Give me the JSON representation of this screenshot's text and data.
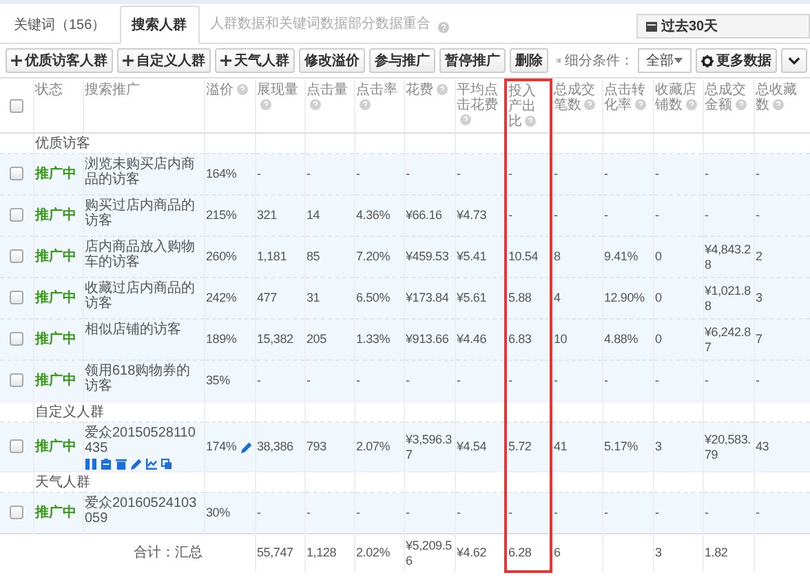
{
  "tabs": [
    {
      "label": "关键词（156）",
      "selected": false
    },
    {
      "label": "搜索人群",
      "selected": true
    }
  ],
  "tab_note": "人群数据和关键词数据部分数据重合",
  "date_button": "过去30天",
  "toolbar": [
    {
      "label": "优质访客人群",
      "kind": "add"
    },
    {
      "label": "自定义人群",
      "kind": "add"
    },
    {
      "label": "天气人群",
      "kind": "add"
    },
    {
      "label": "修改溢价",
      "kind": "plain"
    },
    {
      "label": "参与推广",
      "kind": "plain"
    },
    {
      "label": "暂停推广",
      "kind": "plain"
    },
    {
      "label": "删除",
      "kind": "plain"
    }
  ],
  "filter": {
    "label": "细分条件：",
    "value": "全部"
  },
  "more_button": "更多数据",
  "columns": [
    {
      "label": "状态",
      "help": false,
      "highlighted": false
    },
    {
      "label": "搜索推广",
      "help": false,
      "highlighted": false
    },
    {
      "label": "溢价",
      "help": true,
      "highlighted": false
    },
    {
      "label": "展现量",
      "help": true,
      "highlighted": false
    },
    {
      "label": "点击量",
      "help": true,
      "highlighted": false
    },
    {
      "label": "点击率",
      "help": true,
      "highlighted": false
    },
    {
      "label": "花费",
      "help": true,
      "highlighted": false
    },
    {
      "label": "平均点击花费",
      "help": true,
      "highlighted": false
    },
    {
      "label": "投入产出比",
      "help": true,
      "highlighted": true
    },
    {
      "label": "总成交笔数",
      "help": true,
      "highlighted": false
    },
    {
      "label": "点击转化率",
      "help": true,
      "highlighted": false
    },
    {
      "label": "收藏店铺数",
      "help": true,
      "highlighted": false
    },
    {
      "label": "总成交金额",
      "help": true,
      "highlighted": false
    },
    {
      "label": "总收藏数",
      "help": true,
      "highlighted": false
    }
  ],
  "rows": [
    {
      "kind": "group",
      "label": "优质访客"
    },
    {
      "kind": "item",
      "checked": false,
      "status": "推广中",
      "name": "浏览未购买店内商品的访客",
      "actions": false,
      "premium": "164%",
      "values": [
        "-",
        "-",
        "-",
        "-",
        "-",
        "-",
        "-",
        "-",
        "-",
        "-",
        "-"
      ]
    },
    {
      "kind": "item",
      "checked": false,
      "status": "推广中",
      "name": "购买过店内商品的访客",
      "actions": false,
      "premium": "215%",
      "values": [
        "321",
        "14",
        "4.36%",
        "¥66.16",
        "¥4.73",
        "-",
        "-",
        "-",
        "-",
        "-",
        "-"
      ]
    },
    {
      "kind": "item",
      "checked": false,
      "status": "推广中",
      "name": "店内商品放入购物车的访客",
      "actions": false,
      "premium": "260%",
      "values": [
        "1,181",
        "85",
        "7.20%",
        "¥459.53",
        "¥5.41",
        "10.54",
        "8",
        "9.41%",
        "0",
        "¥4,843.28",
        "2"
      ]
    },
    {
      "kind": "item",
      "checked": false,
      "status": "推广中",
      "name": "收藏过店内商品的访客",
      "actions": false,
      "premium": "242%",
      "values": [
        "477",
        "31",
        "6.50%",
        "¥173.84",
        "¥5.61",
        "5.88",
        "4",
        "12.90%",
        "0",
        "¥1,021.88",
        "3"
      ]
    },
    {
      "kind": "item",
      "checked": false,
      "status": "推广中",
      "name": "相似店铺的访客",
      "actions": false,
      "premium": "189%",
      "values": [
        "15,382",
        "205",
        "1.33%",
        "¥913.66",
        "¥4.46",
        "6.83",
        "10",
        "4.88%",
        "0",
        "¥6,242.87",
        "7"
      ]
    },
    {
      "kind": "item",
      "checked": false,
      "status": "推广中",
      "name": "领用618购物券的访客",
      "actions": false,
      "premium": "35%",
      "values": [
        "-",
        "-",
        "-",
        "-",
        "-",
        "-",
        "-",
        "-",
        "-",
        "-",
        "-"
      ]
    },
    {
      "kind": "group",
      "label": "自定义人群"
    },
    {
      "kind": "item",
      "checked": false,
      "status": "推广中",
      "name": "爱众20150528110435",
      "actions": true,
      "premium": "174%",
      "values": [
        "38,386",
        "793",
        "2.07%",
        "¥3,596.37",
        "¥4.54",
        "5.72",
        "41",
        "5.17%",
        "3",
        "¥20,583.79",
        "43"
      ]
    },
    {
      "kind": "group",
      "label": "天气人群"
    },
    {
      "kind": "item",
      "checked": false,
      "status": "推广中",
      "name": "爱众20160524103059",
      "actions": false,
      "premium": "30%",
      "values": [
        "-",
        "-",
        "-",
        "-",
        "-",
        "-",
        "-",
        "-",
        "-",
        "-",
        "-"
      ]
    },
    {
      "kind": "total",
      "caption": "合计：汇总",
      "cells": [
        {
          "text": "55,747"
        },
        {
          "text": "1,128"
        },
        {
          "text": "2.02%"
        },
        {
          "text": "¥5,209.56"
        },
        {
          "text": "¥4.62"
        },
        {
          "text": "6.28"
        },
        {
          "text": "6"
        },
        {
          "obscured": true
        },
        {
          "text": "3"
        },
        {
          "text": "1.82"
        },
        {
          "obscured": true
        }
      ]
    }
  ],
  "select_all": {
    "checked": false
  }
}
